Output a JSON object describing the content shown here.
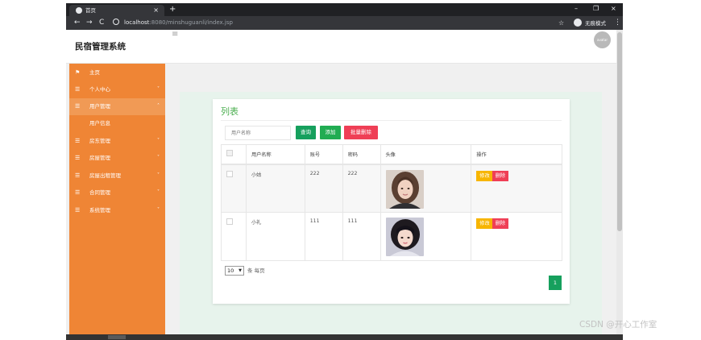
{
  "browser": {
    "tab_title": "首页",
    "tab_close": "×",
    "new_tab": "+",
    "win_min": "–",
    "win_max": "❐",
    "win_close": "×",
    "nav_back": "←",
    "nav_forward": "→",
    "nav_reload": "C",
    "url_host": "localhost",
    "url_rest": ":8080/minshuguanli/index.jsp",
    "star": "☆",
    "incognito_label": "无痕模式",
    "menu": "⋮"
  },
  "app": {
    "title": "民宿管理系统",
    "menu_toggle_icon": "≡",
    "avatar_text": "avatar"
  },
  "sidebar": {
    "items": [
      {
        "icon": "⚑",
        "label": "主页",
        "arrow": ""
      },
      {
        "icon": "☰",
        "label": "个人中心",
        "arrow": "˅"
      },
      {
        "icon": "☰",
        "label": "用户管理",
        "arrow": "˄"
      },
      {
        "icon": "☰",
        "label": "房东管理",
        "arrow": "˅"
      },
      {
        "icon": "☰",
        "label": "房屋管理",
        "arrow": "˅"
      },
      {
        "icon": "☰",
        "label": "房屋出租管理",
        "arrow": "˅"
      },
      {
        "icon": "☰",
        "label": "合同管理",
        "arrow": "˅"
      },
      {
        "icon": "☰",
        "label": "系统管理",
        "arrow": "˅"
      }
    ],
    "sub_item": "用户信息"
  },
  "list": {
    "title": "列表",
    "search_placeholder": "用户名称",
    "query_button": "查询",
    "add_button": "添加",
    "batch_delete_button": "批量删除",
    "columns": [
      "用户名称",
      "账号",
      "密码",
      "头像",
      "操作"
    ],
    "rows": [
      {
        "name": "小姑",
        "account": "222",
        "password": "222"
      },
      {
        "name": "小礼",
        "account": "111",
        "password": "111"
      }
    ],
    "edit_label": "修改",
    "delete_label": "删除",
    "page_size": "10",
    "page_size_suffix": "条 每页",
    "current_page": "1"
  },
  "watermark": "CSDN @开心工作室"
}
